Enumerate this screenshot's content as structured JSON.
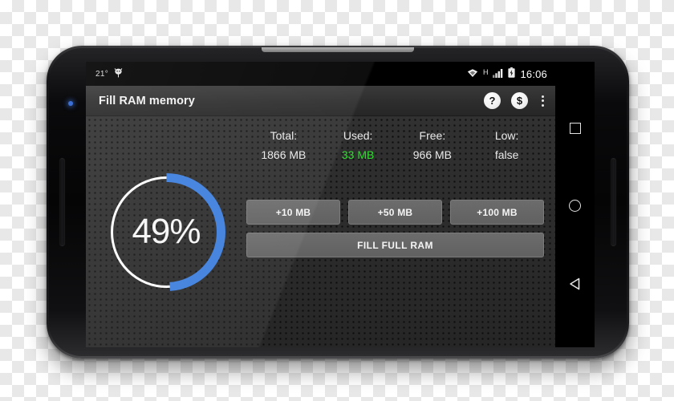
{
  "status_bar": {
    "temperature": "21°",
    "weather_icon": "android-notification-icon",
    "wifi_icon": "wifi-icon",
    "network_type": "H",
    "signal_icon": "signal-bars-icon",
    "battery_icon": "battery-charging-icon",
    "clock": "16:06"
  },
  "action_bar": {
    "title": "Fill RAM memory",
    "help_label": "?",
    "donate_label": "$",
    "overflow_label": "More options"
  },
  "gauge": {
    "percent_label": "49%",
    "percent_value": 49,
    "arc_color": "#3b7ddd",
    "track_color": "#ffffff"
  },
  "stats": [
    {
      "label": "Total:",
      "value": "1866 MB",
      "highlight": false
    },
    {
      "label": "Used:",
      "value": "33 MB",
      "highlight": true
    },
    {
      "label": "Free:",
      "value": "966 MB",
      "highlight": false
    },
    {
      "label": "Low:",
      "value": "false",
      "highlight": false
    }
  ],
  "buttons": {
    "add_10": "+10 MB",
    "add_50": "+50 MB",
    "add_100": "+100 MB",
    "fill_full": "FILL FULL RAM"
  },
  "nav_bar": {
    "recents": "recents-square-icon",
    "home": "home-circle-icon",
    "back": "back-triangle-icon"
  },
  "colors": {
    "accent_blue": "#3b7ddd",
    "used_green": "#2ee02e",
    "content_bg": "#2b2b2b",
    "button_gray": "#666666"
  }
}
